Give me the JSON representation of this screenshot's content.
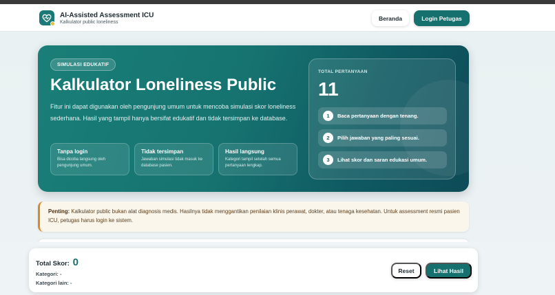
{
  "colors": {
    "primary": "#16706e",
    "accent_warning": "#d9892a",
    "hero_dark": "#0d4b57"
  },
  "navbar": {
    "brand_icon": "heart-pulse-icon",
    "title": "AI-Assisted Assessment ICU",
    "subtitle": "Kalkulator public loneliness",
    "nav_home": "Beranda",
    "nav_login": "Login Petugas"
  },
  "hero": {
    "badge": "SIMULASI EDUKATIF",
    "title": "Kalkulator Loneliness Public",
    "description": "Fitur ini dapat digunakan oleh pengunjung umum untuk mencoba simulasi skor loneliness sederhana. Hasil yang tampil hanya bersifat edukatif dan tidak tersimpan ke database.",
    "features": [
      {
        "title": "Tanpa login",
        "desc": "Bisa dicoba langsung oleh pengunjung umum."
      },
      {
        "title": "Tidak tersimpan",
        "desc": "Jawaban simulasi tidak masuk ke database pasien."
      },
      {
        "title": "Hasil langsung",
        "desc": "Kategori tampil setelah semua pertanyaan lengkap."
      }
    ],
    "stats": {
      "label": "TOTAL PERTANYAAN",
      "value": "11",
      "steps": [
        {
          "num": "1",
          "text": "Baca pertanyaan dengan tenang."
        },
        {
          "num": "2",
          "text": "Pilih jawaban yang paling sesuai."
        },
        {
          "num": "3",
          "text": "Lihat skor dan saran edukasi umum."
        }
      ]
    }
  },
  "notice": {
    "label": "Penting:",
    "text": "Kalkulator public bukan alat diagnosis medis. Hasilnya tidak menggantikan penilaian klinis perawat, dokter, atau tenaga kesehatan. Untuk assessment resmi pasien ICU, petugas harus login ke sistem."
  },
  "footer": {
    "total_label": "Total Skor:",
    "total_value": "0",
    "kategori": "Kategori: -",
    "kategori_lain": "Kategori lain: -",
    "reset": "Reset",
    "lihat_hasil": "Lihat Hasil"
  }
}
